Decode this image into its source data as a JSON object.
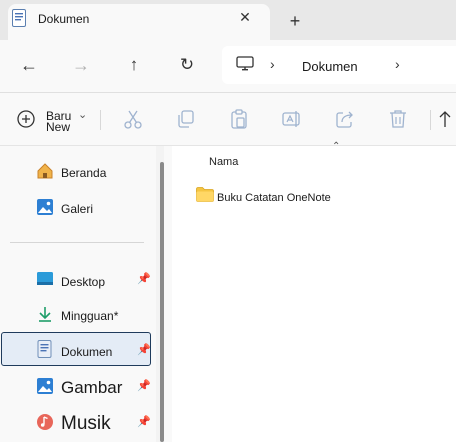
{
  "tab": {
    "title": "Dokumen",
    "icon": "document-icon",
    "close_glyph": "✕",
    "new_glyph": "+"
  },
  "nav": {
    "back_glyph": "←",
    "forward_glyph": "→",
    "up_glyph": "↑",
    "refresh_glyph": "↻",
    "address": {
      "location": "Dokumen",
      "chevron": "›"
    }
  },
  "toolbar": {
    "new_line1": "Baru",
    "new_line2": "New",
    "new_chevron": "⌄",
    "icons": [
      "cut-icon",
      "copy-icon",
      "paste-icon",
      "rename-icon",
      "share-icon",
      "delete-icon",
      "sort-icon"
    ]
  },
  "sidebar": {
    "items": [
      {
        "label": "Beranda",
        "icon": "home-icon",
        "pinned": false
      },
      {
        "label": "Galeri",
        "icon": "gallery-icon",
        "pinned": false
      },
      {
        "label": "Desktop",
        "icon": "desktop-icon",
        "pinned": true
      },
      {
        "label": "Mingguan*",
        "icon": "download-icon",
        "pinned": false
      },
      {
        "label": "Dokumen",
        "icon": "document-icon",
        "pinned": true,
        "selected": true
      },
      {
        "label": "Gambar",
        "icon": "pictures-icon",
        "pinned": true
      },
      {
        "label": "Musik",
        "icon": "music-icon",
        "pinned": true
      }
    ],
    "pin_glyph": "📌"
  },
  "content": {
    "column_header": "Nama",
    "sort_glyph": "⌃",
    "files": [
      {
        "name": "Buku Catatan OneNote",
        "icon": "folder-icon"
      }
    ]
  },
  "colors": {
    "accent": "#1f6fd1",
    "folder": "#f5c542",
    "selection_border": "#1f3b5c"
  }
}
